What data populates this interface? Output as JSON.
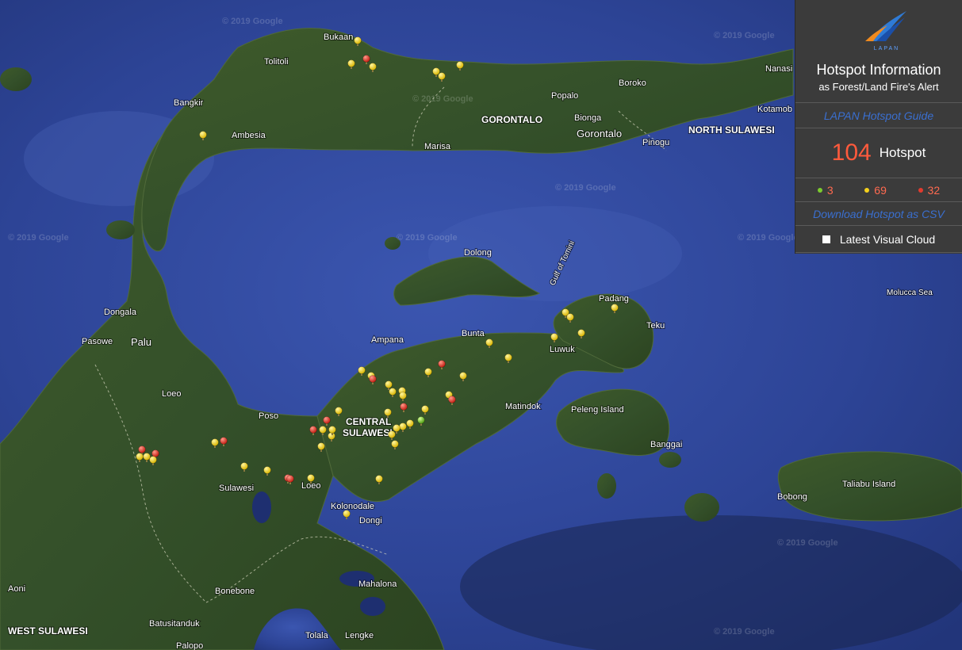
{
  "panel": {
    "logo_text": "LAPAN",
    "title": "Hotspot Information",
    "subtitle": "as Forest/Land Fire's Alert",
    "guide_link": "LAPAN Hotspot Guide",
    "total": "104",
    "total_unit": "Hotspot",
    "legend": [
      {
        "color": "#7ccb2e",
        "count": "3"
      },
      {
        "color": "#f4d01c",
        "count": "69"
      },
      {
        "color": "#e23b2e",
        "count": "32"
      }
    ],
    "download_link": "Download Hotspot as CSV",
    "cloud_label": "Latest Visual Cloud"
  },
  "map": {
    "watermark": "© 2019 Google",
    "region_labels": [
      "GORONTALO",
      "NORTH SULAWESI",
      "CENTRAL",
      "SULAWESI",
      "WEST SULAWESI"
    ],
    "place_labels": [
      "Bukaan",
      "Tolitoli",
      "Bangkir",
      "Ambesia",
      "Popalo",
      "Boroko",
      "Nanasi",
      "Kotamob",
      "Bionga",
      "Gorontalo",
      "Pinogu",
      "Marisa",
      "Dolong",
      "Gulf of Tomini",
      "Padang",
      "Teku",
      "Molucca Sea",
      "Dongala",
      "Pasowe",
      "Palu",
      "Loeo",
      "Poso",
      "Ampana",
      "Bunta",
      "Luwuk",
      "Matindok",
      "Peleng Island",
      "Banggai",
      "Taliabu Island",
      "Bobong",
      "Sulawesi",
      "Loeo",
      "Kolonodale",
      "Dongi",
      "Mahalona",
      "Bonebone",
      "Aoni",
      "Batusitanduk",
      "Tolala",
      "Lengke",
      "Palopo"
    ],
    "hotspot_colors": {
      "green": "#7ccb2e",
      "yellow": "#f4d01c",
      "red": "#e23b2e"
    }
  }
}
